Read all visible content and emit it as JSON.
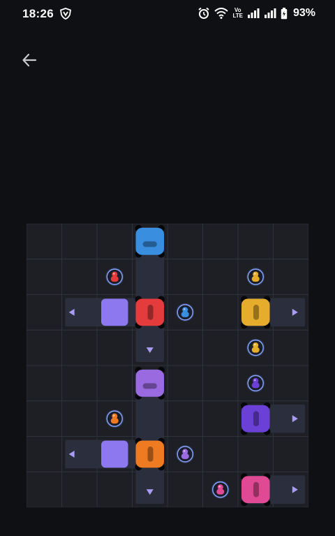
{
  "status_bar": {
    "time": "18:26",
    "battery": "93%",
    "volte_line1": "Vo",
    "volte_line2": "LTE",
    "icons": [
      "vpn-shield-icon",
      "alarm-icon",
      "wifi-icon",
      "volte-icon",
      "signal-icon",
      "signal-icon",
      "battery-icon"
    ]
  },
  "header": {
    "back_icon": "arrow-left-icon"
  },
  "board": {
    "rows": 8,
    "cols": 8,
    "colors": {
      "cell": "#1d1f24",
      "grid_line": "#2e323b",
      "lane": "#2b2f3d",
      "arrow": "#a99cf2",
      "block": "#8e78f0",
      "blue": "#3a8ee0",
      "red": "#e43c3c",
      "orange": "#ee7a22",
      "yellow": "#e6ad2c",
      "purple": "#9a6ae0",
      "violet": "#6a40d6",
      "pink": "#e04a94"
    },
    "lanes": [
      {
        "orientation": "horizontal",
        "row": 2,
        "from_col": 1,
        "to_col": 3,
        "direction": "left"
      },
      {
        "orientation": "horizontal",
        "row": 6,
        "from_col": 1,
        "to_col": 3,
        "direction": "left"
      },
      {
        "orientation": "horizontal",
        "row": 2,
        "from_col": 6,
        "to_col": 7,
        "direction": "right"
      },
      {
        "orientation": "horizontal",
        "row": 5,
        "from_col": 6,
        "to_col": 7,
        "direction": "right"
      },
      {
        "orientation": "horizontal",
        "row": 7,
        "from_col": 6,
        "to_col": 7,
        "direction": "right"
      },
      {
        "orientation": "vertical",
        "col": 3,
        "from_row": 0,
        "to_row": 3,
        "direction": "down"
      },
      {
        "orientation": "vertical",
        "col": 3,
        "from_row": 4,
        "to_row": 7,
        "direction": "down"
      }
    ],
    "blocks": [
      {
        "row": 2,
        "col": 2
      },
      {
        "row": 6,
        "col": 2
      }
    ],
    "cars": [
      {
        "color": "blue",
        "row": 0,
        "col": 3,
        "facing": "vertical"
      },
      {
        "color": "red",
        "row": 2,
        "col": 3,
        "facing": "horizontal"
      },
      {
        "color": "purple",
        "row": 4,
        "col": 3,
        "facing": "vertical"
      },
      {
        "color": "orange",
        "row": 6,
        "col": 3,
        "facing": "horizontal"
      },
      {
        "color": "yellow",
        "row": 2,
        "col": 6,
        "facing": "horizontal"
      },
      {
        "color": "violet",
        "row": 5,
        "col": 6,
        "facing": "horizontal"
      },
      {
        "color": "pink",
        "row": 7,
        "col": 6,
        "facing": "horizontal"
      }
    ],
    "passengers": [
      {
        "color": "red",
        "row": 1,
        "col": 2
      },
      {
        "color": "yellow",
        "row": 1,
        "col": 6
      },
      {
        "color": "blue",
        "row": 2,
        "col": 4
      },
      {
        "color": "yellow",
        "row": 3,
        "col": 6
      },
      {
        "color": "violet",
        "row": 4,
        "col": 6
      },
      {
        "color": "orange",
        "row": 5,
        "col": 2
      },
      {
        "color": "purple",
        "row": 6,
        "col": 4
      },
      {
        "color": "pink",
        "row": 7,
        "col": 5
      }
    ]
  }
}
